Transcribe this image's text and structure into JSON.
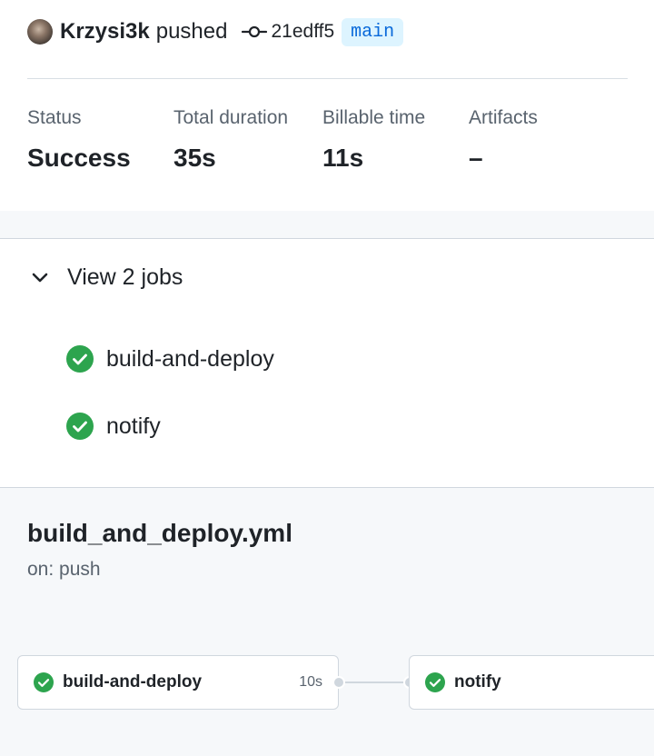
{
  "summary": {
    "actor": "Krzysi3k",
    "action": "pushed",
    "commit_sha": "21edff5",
    "branch": "main",
    "stats": [
      {
        "label": "Status",
        "value": "Success"
      },
      {
        "label": "Total duration",
        "value": "35s"
      },
      {
        "label": "Billable time",
        "value": "11s"
      },
      {
        "label": "Artifacts",
        "value": "–"
      }
    ]
  },
  "jobs": {
    "toggle_label": "View 2 jobs",
    "items": [
      {
        "label": "build-and-deploy",
        "status": "success"
      },
      {
        "label": "notify",
        "status": "success"
      }
    ]
  },
  "workflow": {
    "filename": "build_and_deploy.yml",
    "trigger": "on: push",
    "graph_jobs": [
      {
        "label": "build-and-deploy",
        "duration": "10s",
        "status": "success"
      },
      {
        "label": "notify",
        "duration": "",
        "status": "success"
      }
    ]
  },
  "colors": {
    "success": "#2da44e",
    "branch_bg": "#ddf4ff",
    "branch_fg": "#0969da",
    "muted_text": "#59636e",
    "border": "#d0d7de"
  },
  "icons": {
    "commit": "git-commit-icon",
    "chevron": "chevron-down-icon",
    "success": "check-circle-fill-icon"
  }
}
